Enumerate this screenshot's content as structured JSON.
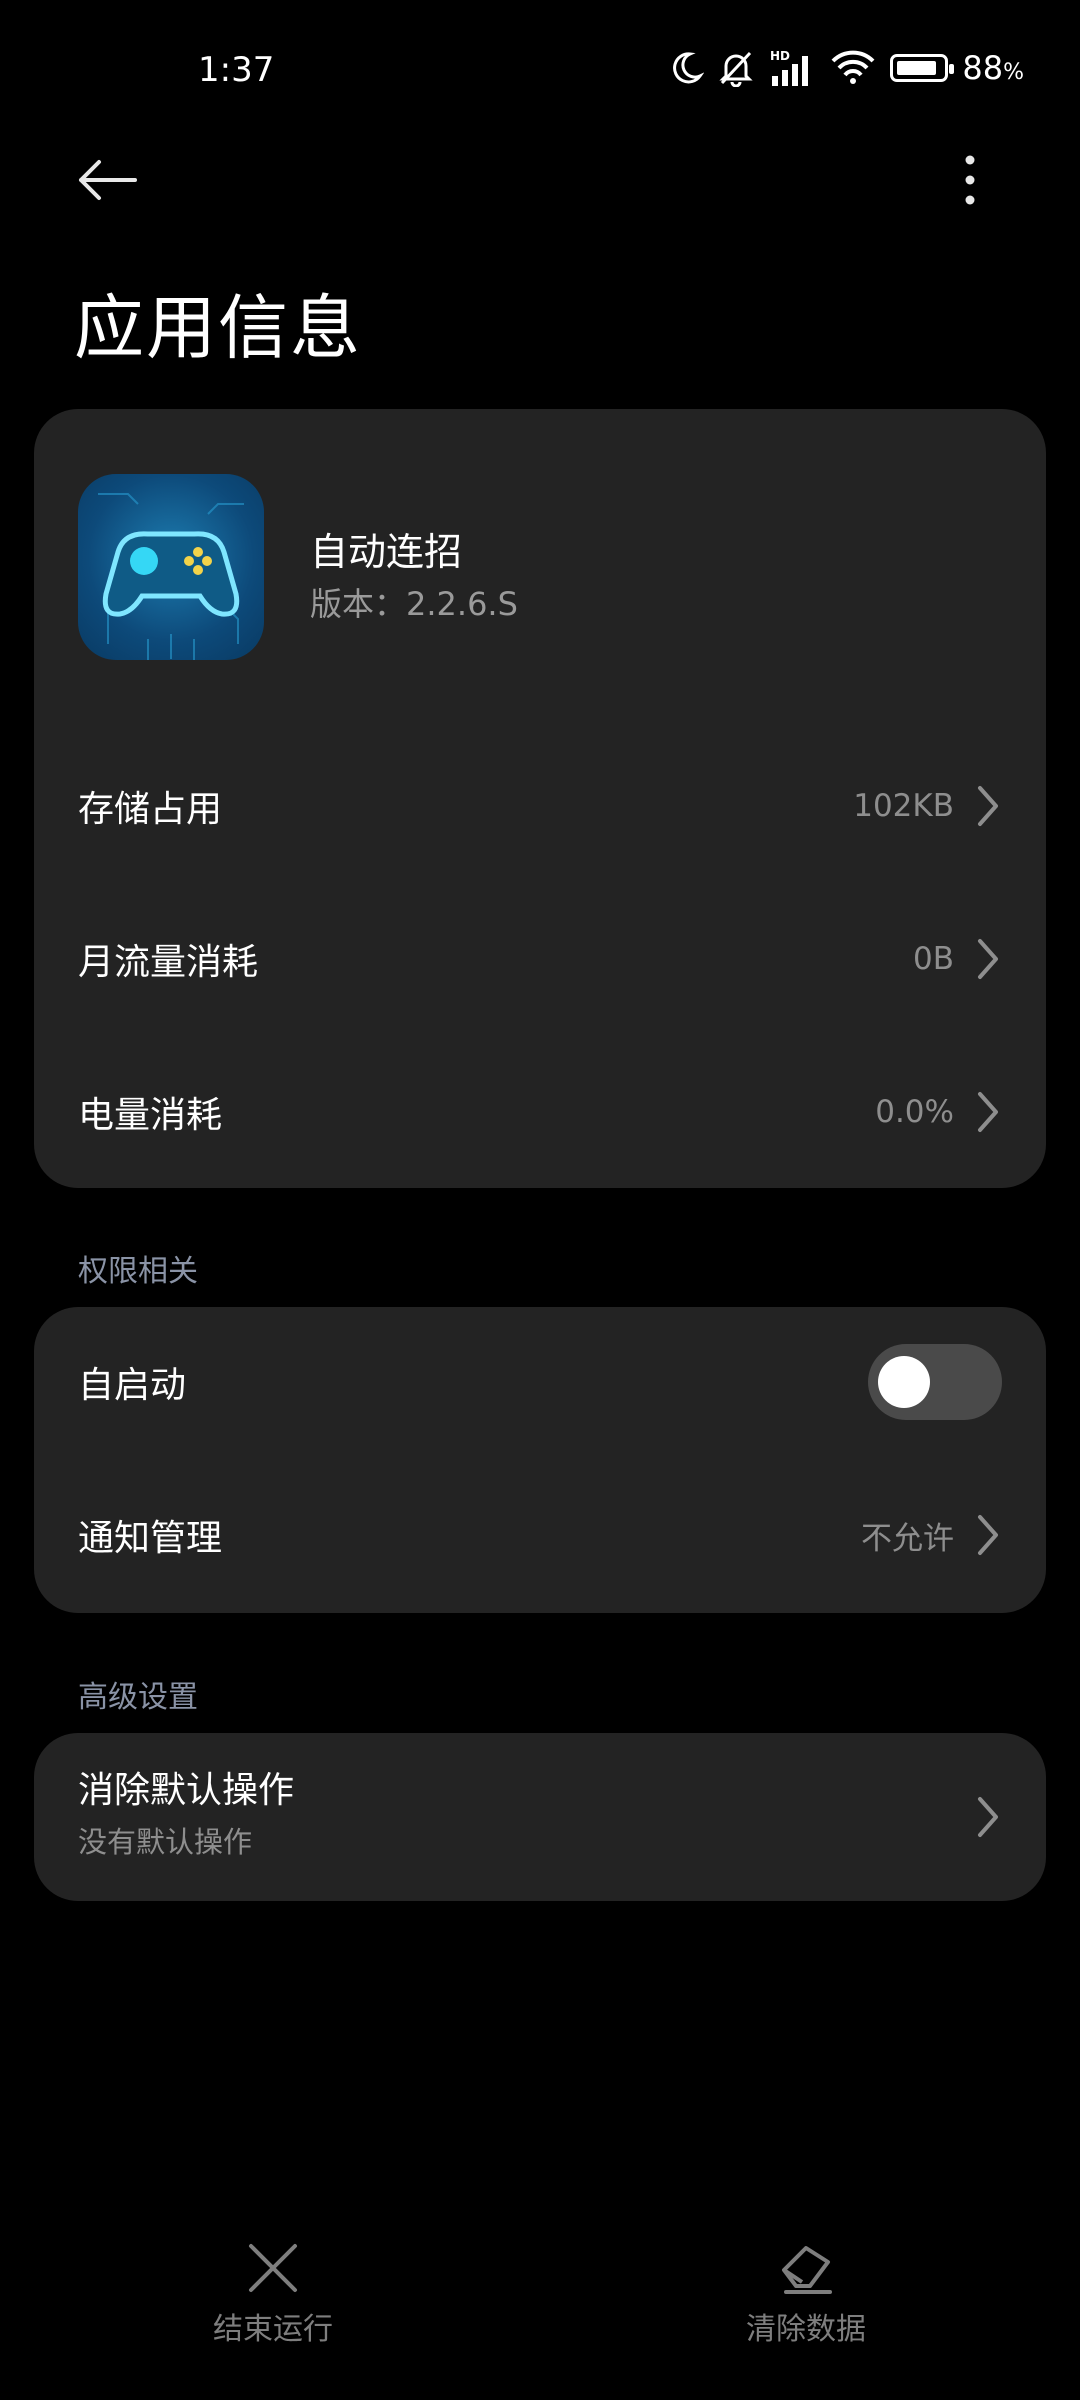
{
  "status_bar": {
    "time": "1:37",
    "battery_percent": "88",
    "battery_percent_sign": "%",
    "battery_level": 0.88,
    "icons": [
      "moon-icon",
      "bell-off-icon",
      "hd-signal-icon",
      "wifi-icon",
      "battery-icon"
    ]
  },
  "header": {
    "title": "应用信息"
  },
  "app": {
    "name": "自动连招",
    "version": "版本：2.2.6.S"
  },
  "usage": [
    {
      "label": "存储占用",
      "value": "102KB"
    },
    {
      "label": "月流量消耗",
      "value": "0B"
    },
    {
      "label": "电量消耗",
      "value": "0.0%"
    }
  ],
  "permissions": {
    "section_title": "权限相关",
    "autostart_label": "自启动",
    "autostart_on": false,
    "notification_label": "通知管理",
    "notification_value": "不允许"
  },
  "advanced": {
    "section_title": "高级设置",
    "clear_default_label": "消除默认操作",
    "clear_default_sub": "没有默认操作"
  },
  "bottom_actions": {
    "end_run": "结束运行",
    "clear_data": "清除数据"
  }
}
